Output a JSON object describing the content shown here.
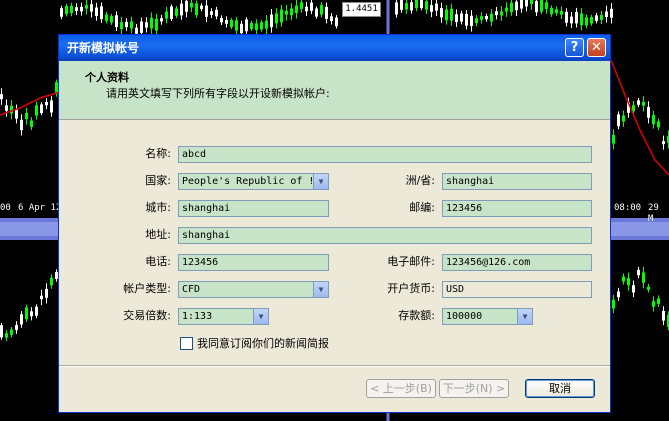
{
  "background": {
    "price_label": "1.4451",
    "axis_labels": [
      "00",
      "6 Apr 12",
      "08:00",
      "29 M"
    ]
  },
  "dialog": {
    "title": "开新模拟帐号",
    "help_glyph": "?",
    "close_glyph": "✕",
    "header": {
      "title": "个人资料",
      "subtitle": "请用英文填写下列所有字段以开设新模拟帐户:"
    },
    "form": {
      "name": {
        "label": "名称:",
        "value": "abcd"
      },
      "country": {
        "label": "国家:",
        "value": "People's Republic of !"
      },
      "state": {
        "label": "洲/省:",
        "value": "shanghai"
      },
      "city": {
        "label": "城市:",
        "value": "shanghai"
      },
      "zip": {
        "label": "邮编:",
        "value": "123456"
      },
      "address": {
        "label": "地址:",
        "value": "shanghai"
      },
      "phone": {
        "label": "电话:",
        "value": "123456"
      },
      "email": {
        "label": "电子邮件:",
        "value": "123456@126.com"
      },
      "account_type": {
        "label": "帐户类型:",
        "value": "CFD"
      },
      "currency": {
        "label": "开户货币:",
        "value": "USD"
      },
      "leverage": {
        "label": "交易倍数:",
        "value": "1:133"
      },
      "deposit": {
        "label": "存款额:",
        "value": "100000"
      },
      "newsletter": {
        "label": "我同意订阅你们的新闻简报",
        "checked": false
      }
    },
    "buttons": {
      "back": "< 上一步(B)",
      "next": "下一步(N) >",
      "cancel": "取消"
    }
  },
  "colors": {
    "titlebar": "#0a5ee8",
    "field_bg": "#c8e4c8",
    "dialog_bg": "#ece9d8",
    "chart_bg": "#000000",
    "candle_up": "#00ff00",
    "candle_down": "#ffffff",
    "ma_line": "#ff0000"
  },
  "icons": {
    "dropdown": "chevron-down-icon",
    "help": "help-icon",
    "close": "close-icon"
  }
}
